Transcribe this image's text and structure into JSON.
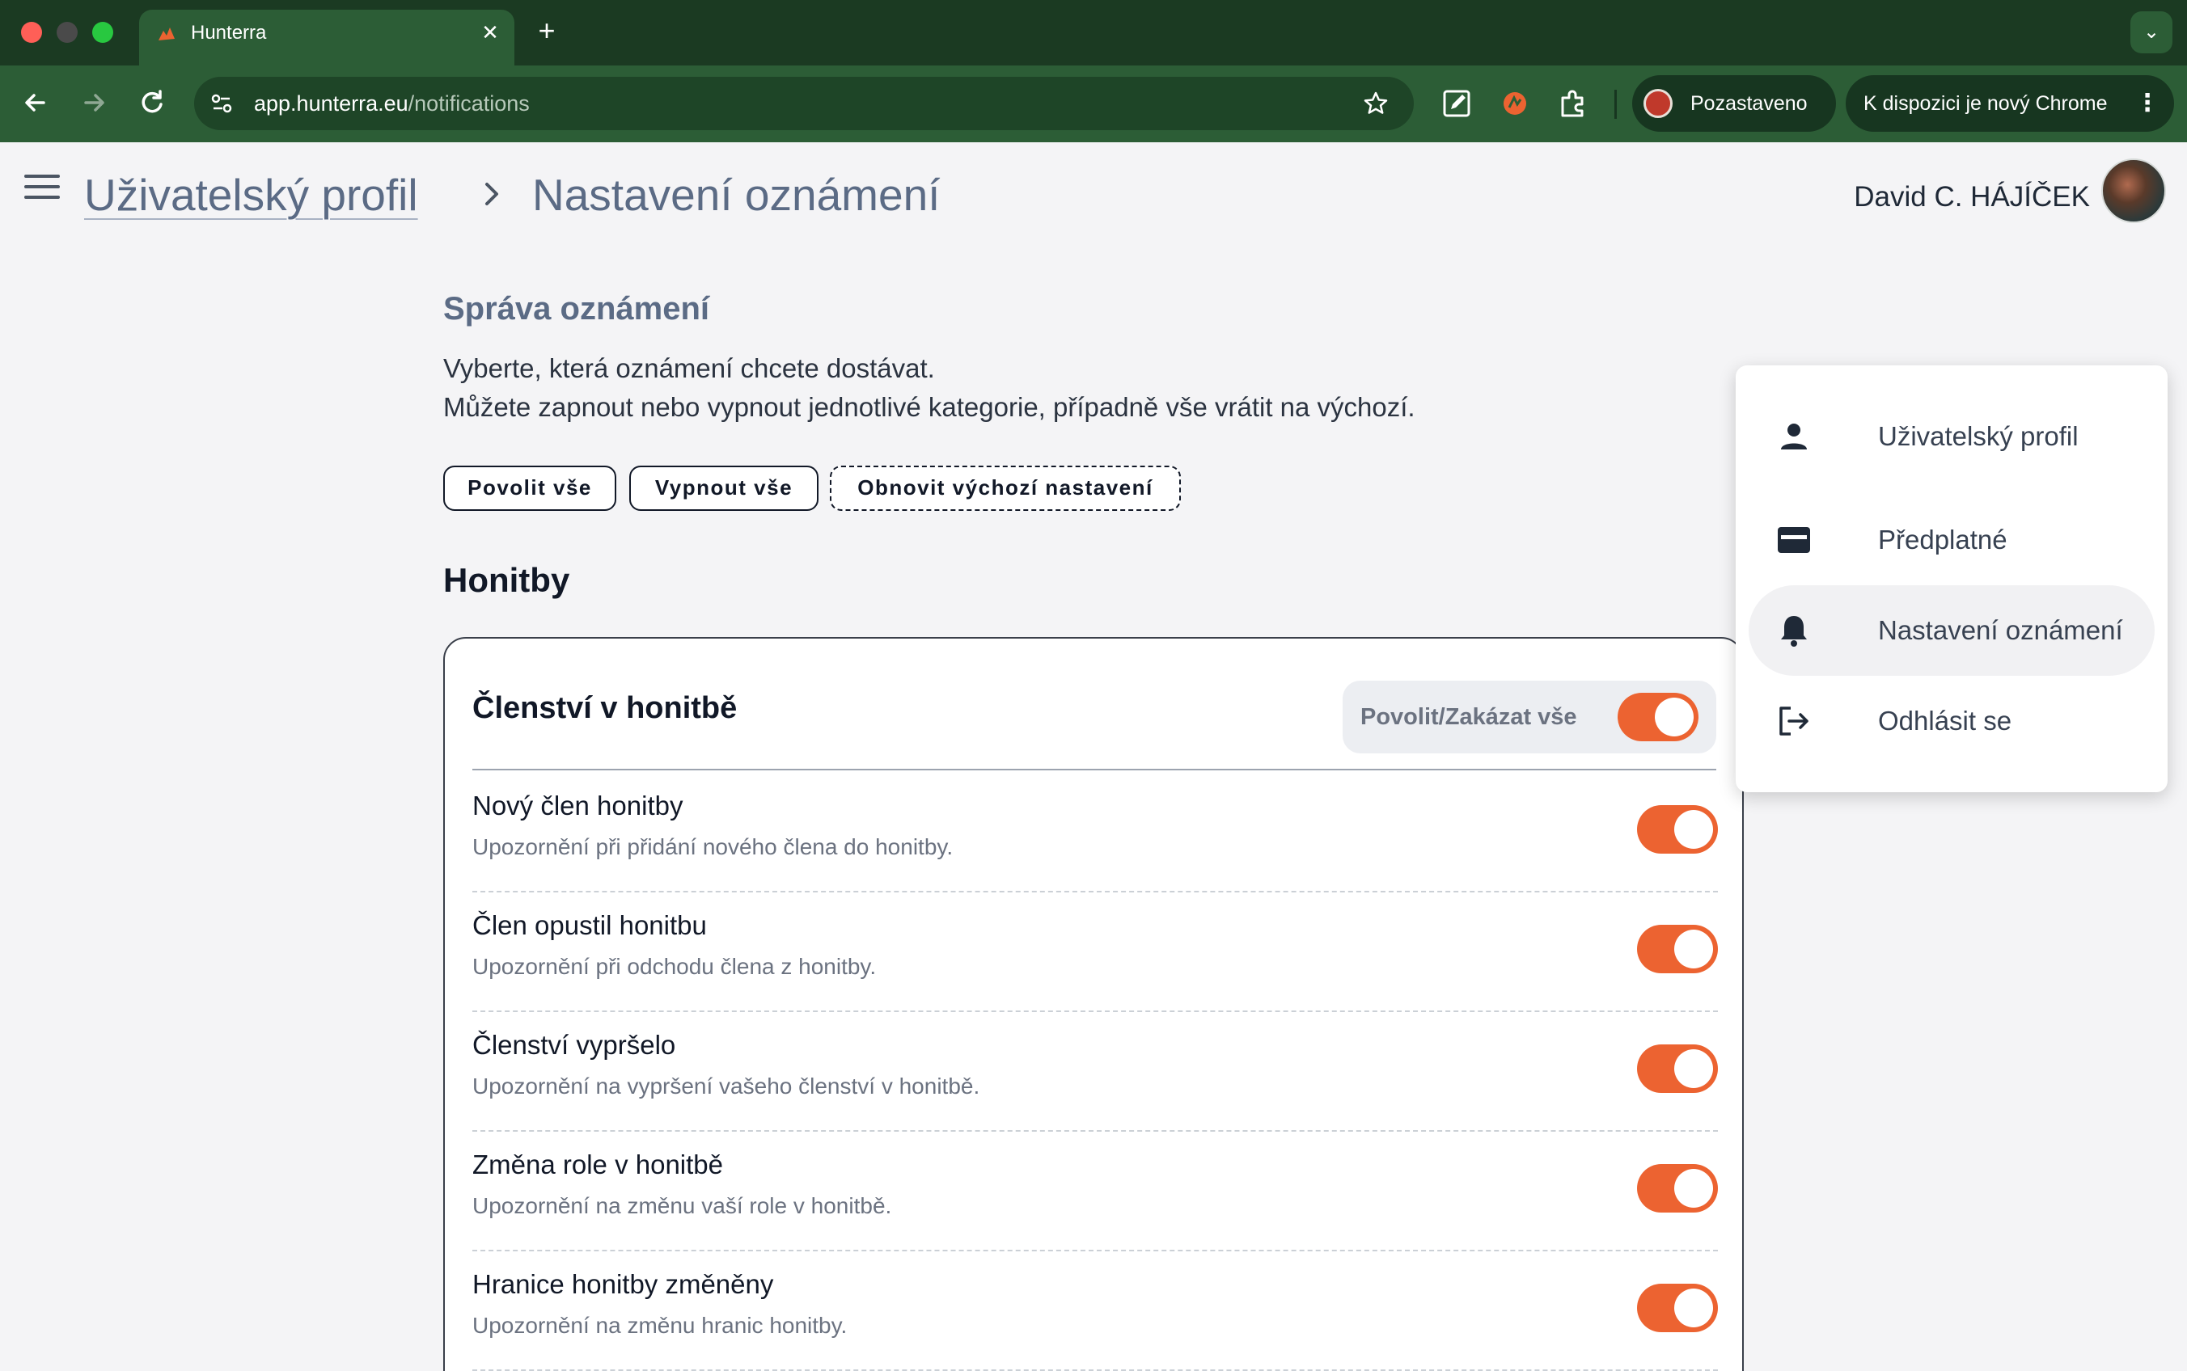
{
  "browser": {
    "tab_title": "Hunterra",
    "url_host": "app.hunterra.eu",
    "url_path": "/notifications",
    "profile_status": "Pozastaveno",
    "chrome_update": "K dispozici je nový Chrome",
    "colors": {
      "frame": "#1b3a22",
      "toolbar": "#2c5d36"
    }
  },
  "header": {
    "breadcrumb": [
      "Uživatelský profil",
      "Nastavení oznámení"
    ],
    "user_name": "David C. HÁJÍČEK"
  },
  "user_menu": {
    "items": [
      {
        "icon": "person-icon",
        "label": "Uživatelský profil"
      },
      {
        "icon": "card-icon",
        "label": "Předplatné"
      },
      {
        "icon": "bell-icon",
        "label": "Nastavení oznámení",
        "active": true
      },
      {
        "icon": "logout-icon",
        "label": "Odhlásit se"
      }
    ]
  },
  "main": {
    "section_title": "Správa oznámení",
    "description_line1": "Vyberte, která oznámení chcete dostávat.",
    "description_line2": "Můžete zapnout nebo vypnout jednotlivé kategorie, případně vše vrátit na výchozí.",
    "actions": {
      "enable_all": "Povolit vše",
      "disable_all": "Vypnout vše",
      "reset_defaults": "Obnovit výchozí nastavení"
    },
    "group_title": "Honitby",
    "card": {
      "title": "Členství v honitbě",
      "master_label": "Povolit/Zakázat vše",
      "master_on": true,
      "items": [
        {
          "title": "Nový člen honitby",
          "subtitle": "Upozornění při přidání nového člena do honitby.",
          "enabled": true
        },
        {
          "title": "Člen opustil honitbu",
          "subtitle": "Upozornění při odchodu člena z honitby.",
          "enabled": true
        },
        {
          "title": "Členství vypršelo",
          "subtitle": "Upozornění na vypršení vašeho členství v honitbě.",
          "enabled": true
        },
        {
          "title": "Změna role v honitbě",
          "subtitle": "Upozornění na změnu vaší role v honitbě.",
          "enabled": true
        },
        {
          "title": "Hranice honitby změněny",
          "subtitle": "Upozornění na změnu hranic honitby.",
          "enabled": true
        }
      ]
    }
  },
  "theme": {
    "accent": "#ec6331",
    "text_muted": "#5b6b85"
  }
}
